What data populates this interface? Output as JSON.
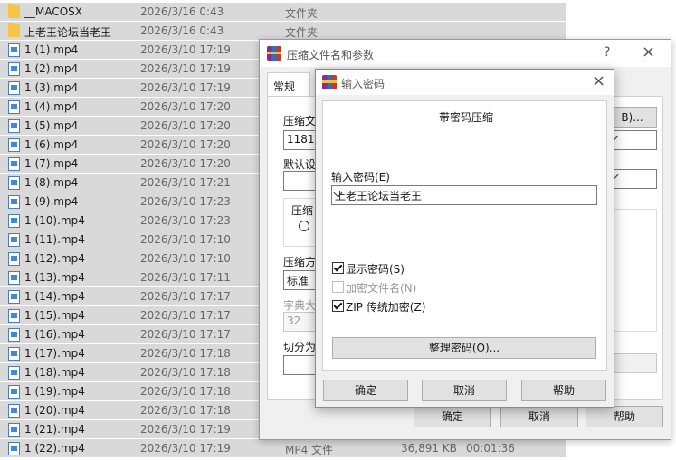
{
  "files": [
    {
      "name": "__MACOSX",
      "date": "2026/3/16 0:43",
      "type": "文件夹",
      "kind": "folder"
    },
    {
      "name": "上老王论坛当老王",
      "date": "2026/3/16 0:43",
      "type": "文件夹",
      "kind": "folder"
    },
    {
      "name": "1 (1).mp4",
      "date": "2026/3/10 17:19",
      "kind": "video"
    },
    {
      "name": "1 (2).mp4",
      "date": "2026/3/10 17:19",
      "kind": "video"
    },
    {
      "name": "1 (3).mp4",
      "date": "2026/3/10 17:19",
      "kind": "video"
    },
    {
      "name": "1 (4).mp4",
      "date": "2026/3/10 17:20",
      "kind": "video"
    },
    {
      "name": "1 (5).mp4",
      "date": "2026/3/10 17:20",
      "kind": "video"
    },
    {
      "name": "1 (6).mp4",
      "date": "2026/3/10 17:20",
      "kind": "video"
    },
    {
      "name": "1 (7).mp4",
      "date": "2026/3/10 17:20",
      "kind": "video"
    },
    {
      "name": "1 (8).mp4",
      "date": "2026/3/10 17:21",
      "kind": "video"
    },
    {
      "name": "1 (9).mp4",
      "date": "2026/3/10 17:23",
      "kind": "video"
    },
    {
      "name": "1 (10).mp4",
      "date": "2026/3/10 17:23",
      "kind": "video"
    },
    {
      "name": "1 (11).mp4",
      "date": "2026/3/10 17:10",
      "kind": "video"
    },
    {
      "name": "1 (12).mp4",
      "date": "2026/3/10 17:10",
      "kind": "video"
    },
    {
      "name": "1 (13).mp4",
      "date": "2026/3/10 17:11",
      "kind": "video"
    },
    {
      "name": "1 (14).mp4",
      "date": "2026/3/10 17:17",
      "kind": "video"
    },
    {
      "name": "1 (15).mp4",
      "date": "2026/3/10 17:17",
      "kind": "video"
    },
    {
      "name": "1 (16).mp4",
      "date": "2026/3/10 17:17",
      "kind": "video"
    },
    {
      "name": "1 (17).mp4",
      "date": "2026/3/10 17:18",
      "kind": "video"
    },
    {
      "name": "1 (18).mp4",
      "date": "2026/3/10 17:18",
      "kind": "video"
    },
    {
      "name": "1 (19).mp4",
      "date": "2026/3/10 17:18",
      "kind": "video"
    },
    {
      "name": "1 (20).mp4",
      "date": "2026/3/10 17:18",
      "kind": "video"
    },
    {
      "name": "1 (21).mp4",
      "date": "2026/3/10 17:19",
      "kind": "video"
    },
    {
      "name": "1 (22).mp4",
      "date": "2026/3/10 17:19",
      "type": "MP4 文件",
      "size": "36,891 KB",
      "duration": "00:01:36",
      "kind": "video"
    }
  ],
  "archive_dialog": {
    "title": "压缩文件名和参数",
    "help": "?",
    "close": "×",
    "tab_general": "常规",
    "archive_name_label": "压缩文",
    "archive_name_value": "1181.z",
    "browse_button": "B)...",
    "default_profile_label": "默认设",
    "format_label": "压缩",
    "method_label": "压缩方",
    "method_value": "标准",
    "dict_label": "字典大",
    "dict_value": "32",
    "split_label": "切分为",
    "ok_button": "确定",
    "cancel_button": "取消",
    "help_button": "帮助"
  },
  "password_dialog": {
    "title": "输入密码",
    "close": "×",
    "heading": "带密码压缩",
    "password_label": "输入密码(E)",
    "password_value": "上老王论坛当老王",
    "show_password": "显示密码(S)",
    "encrypt_filenames": "加密文件名(N)",
    "zip_legacy": "ZIP 传统加密(Z)",
    "organize_button": "整理密码(O)...",
    "ok_button": "确定",
    "cancel_button": "取消",
    "help_button": "帮助",
    "show_password_checked": true,
    "encrypt_filenames_checked": false,
    "zip_legacy_checked": true
  }
}
